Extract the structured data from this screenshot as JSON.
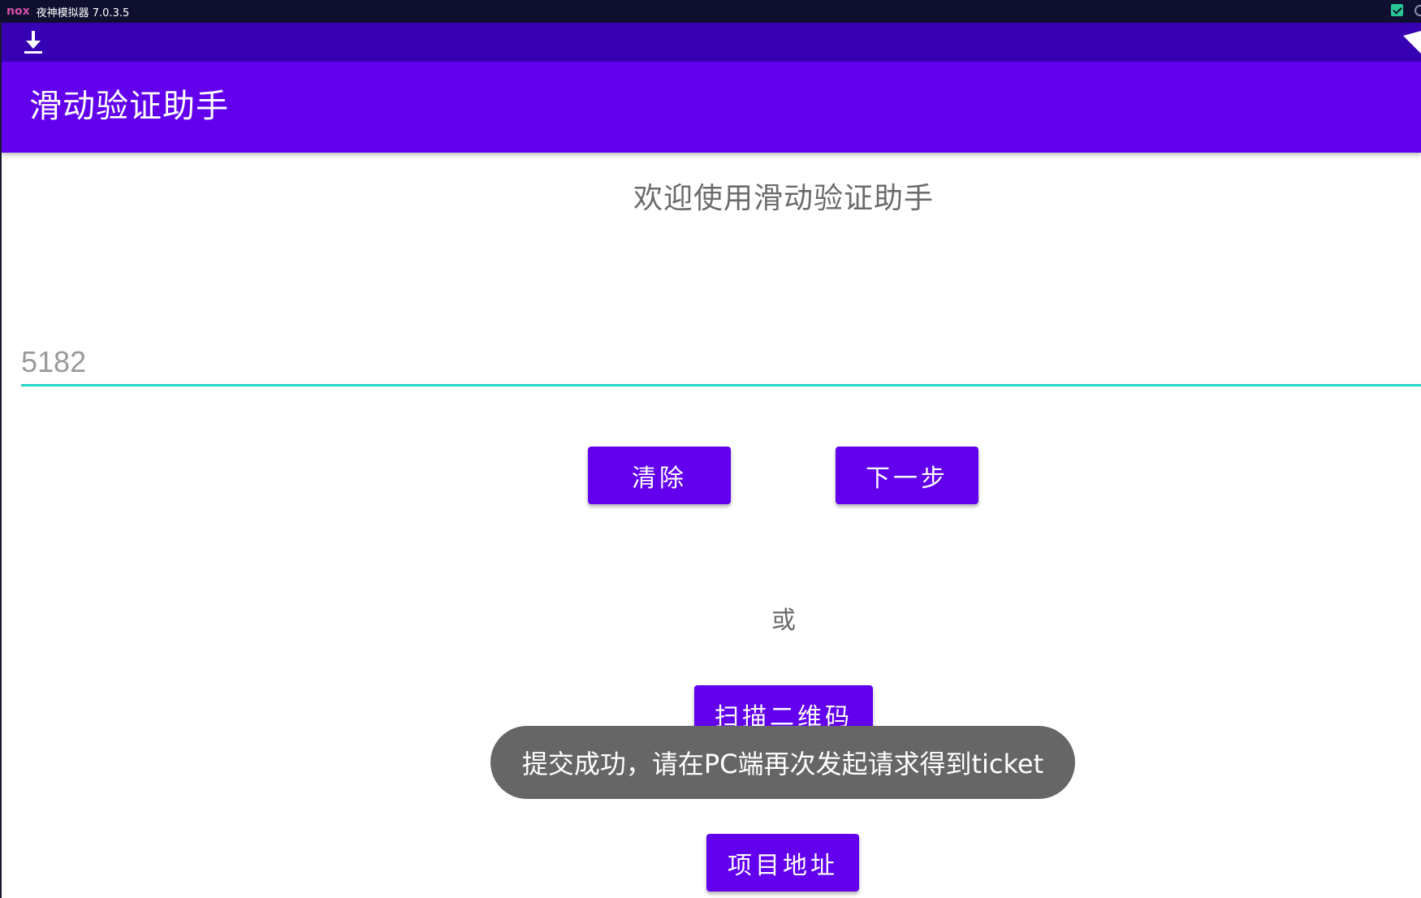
{
  "emulator": {
    "logo": "nox",
    "title": "夜神模拟器 7.0.3.5",
    "right_icon": "check-badge-icon"
  },
  "status_bar": {
    "left_icon": "download-icon",
    "right_icon": "wifi-icon"
  },
  "app_bar": {
    "title": "滑动验证助手"
  },
  "main": {
    "welcome": "欢迎使用滑动验证助手",
    "code_input": {
      "value": "5182",
      "placeholder": ""
    },
    "buttons": {
      "clear": "清除",
      "next": "下一步",
      "scan": "扫描二维码",
      "project": "项目地址"
    },
    "or_text": "或"
  },
  "toast": {
    "message": "提交成功，请在PC端再次发起请求得到ticket"
  },
  "colors": {
    "primary": "#6200ee",
    "primary_dark": "#3700b3",
    "accent": "#2ad3c8",
    "emulator_bar": "#0f1030",
    "toast_bg": "#666666"
  }
}
